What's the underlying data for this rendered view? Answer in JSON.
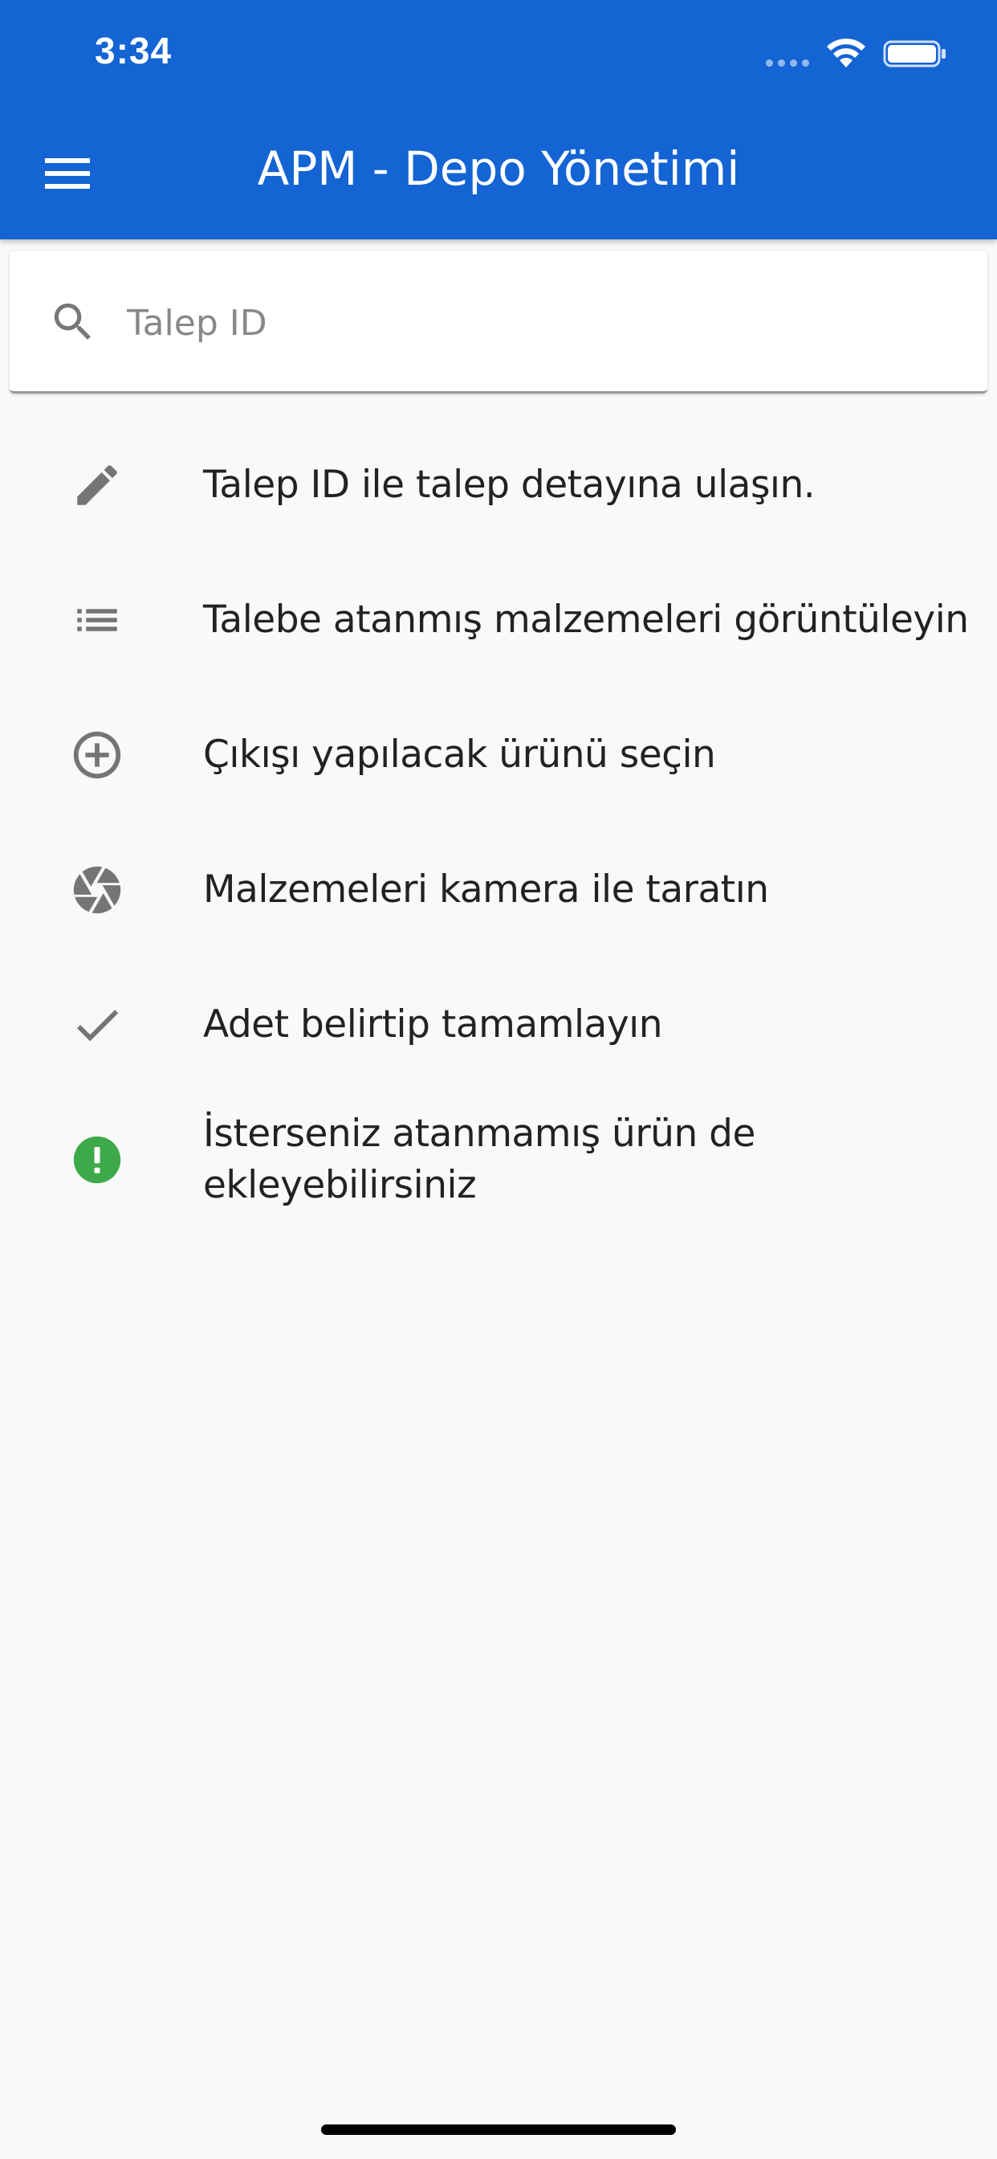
{
  "status_bar": {
    "time": "3:34"
  },
  "appbar": {
    "title": "APM - Depo Yönetimi",
    "color": "#1464d4"
  },
  "search": {
    "placeholder": "Talep ID",
    "value": ""
  },
  "steps": [
    {
      "icon": "pencil-icon",
      "text": "Talep ID ile talep detayına ulaşın."
    },
    {
      "icon": "list-icon",
      "text": "Talebe atanmış malzemeleri görüntüleyin"
    },
    {
      "icon": "add-circle-icon",
      "text": "Çıkışı yapılacak ürünü seçin"
    },
    {
      "icon": "camera-shutter-icon",
      "text": "Malzemeleri kamera ile taratın"
    },
    {
      "icon": "check-icon",
      "text": "Adet belirtip tamamlayın"
    },
    {
      "icon": "alert-circle-icon",
      "text": "İsterseniz atanmamış ürün de ekleyebilirsiniz",
      "icon_color": "#3da94a"
    }
  ]
}
